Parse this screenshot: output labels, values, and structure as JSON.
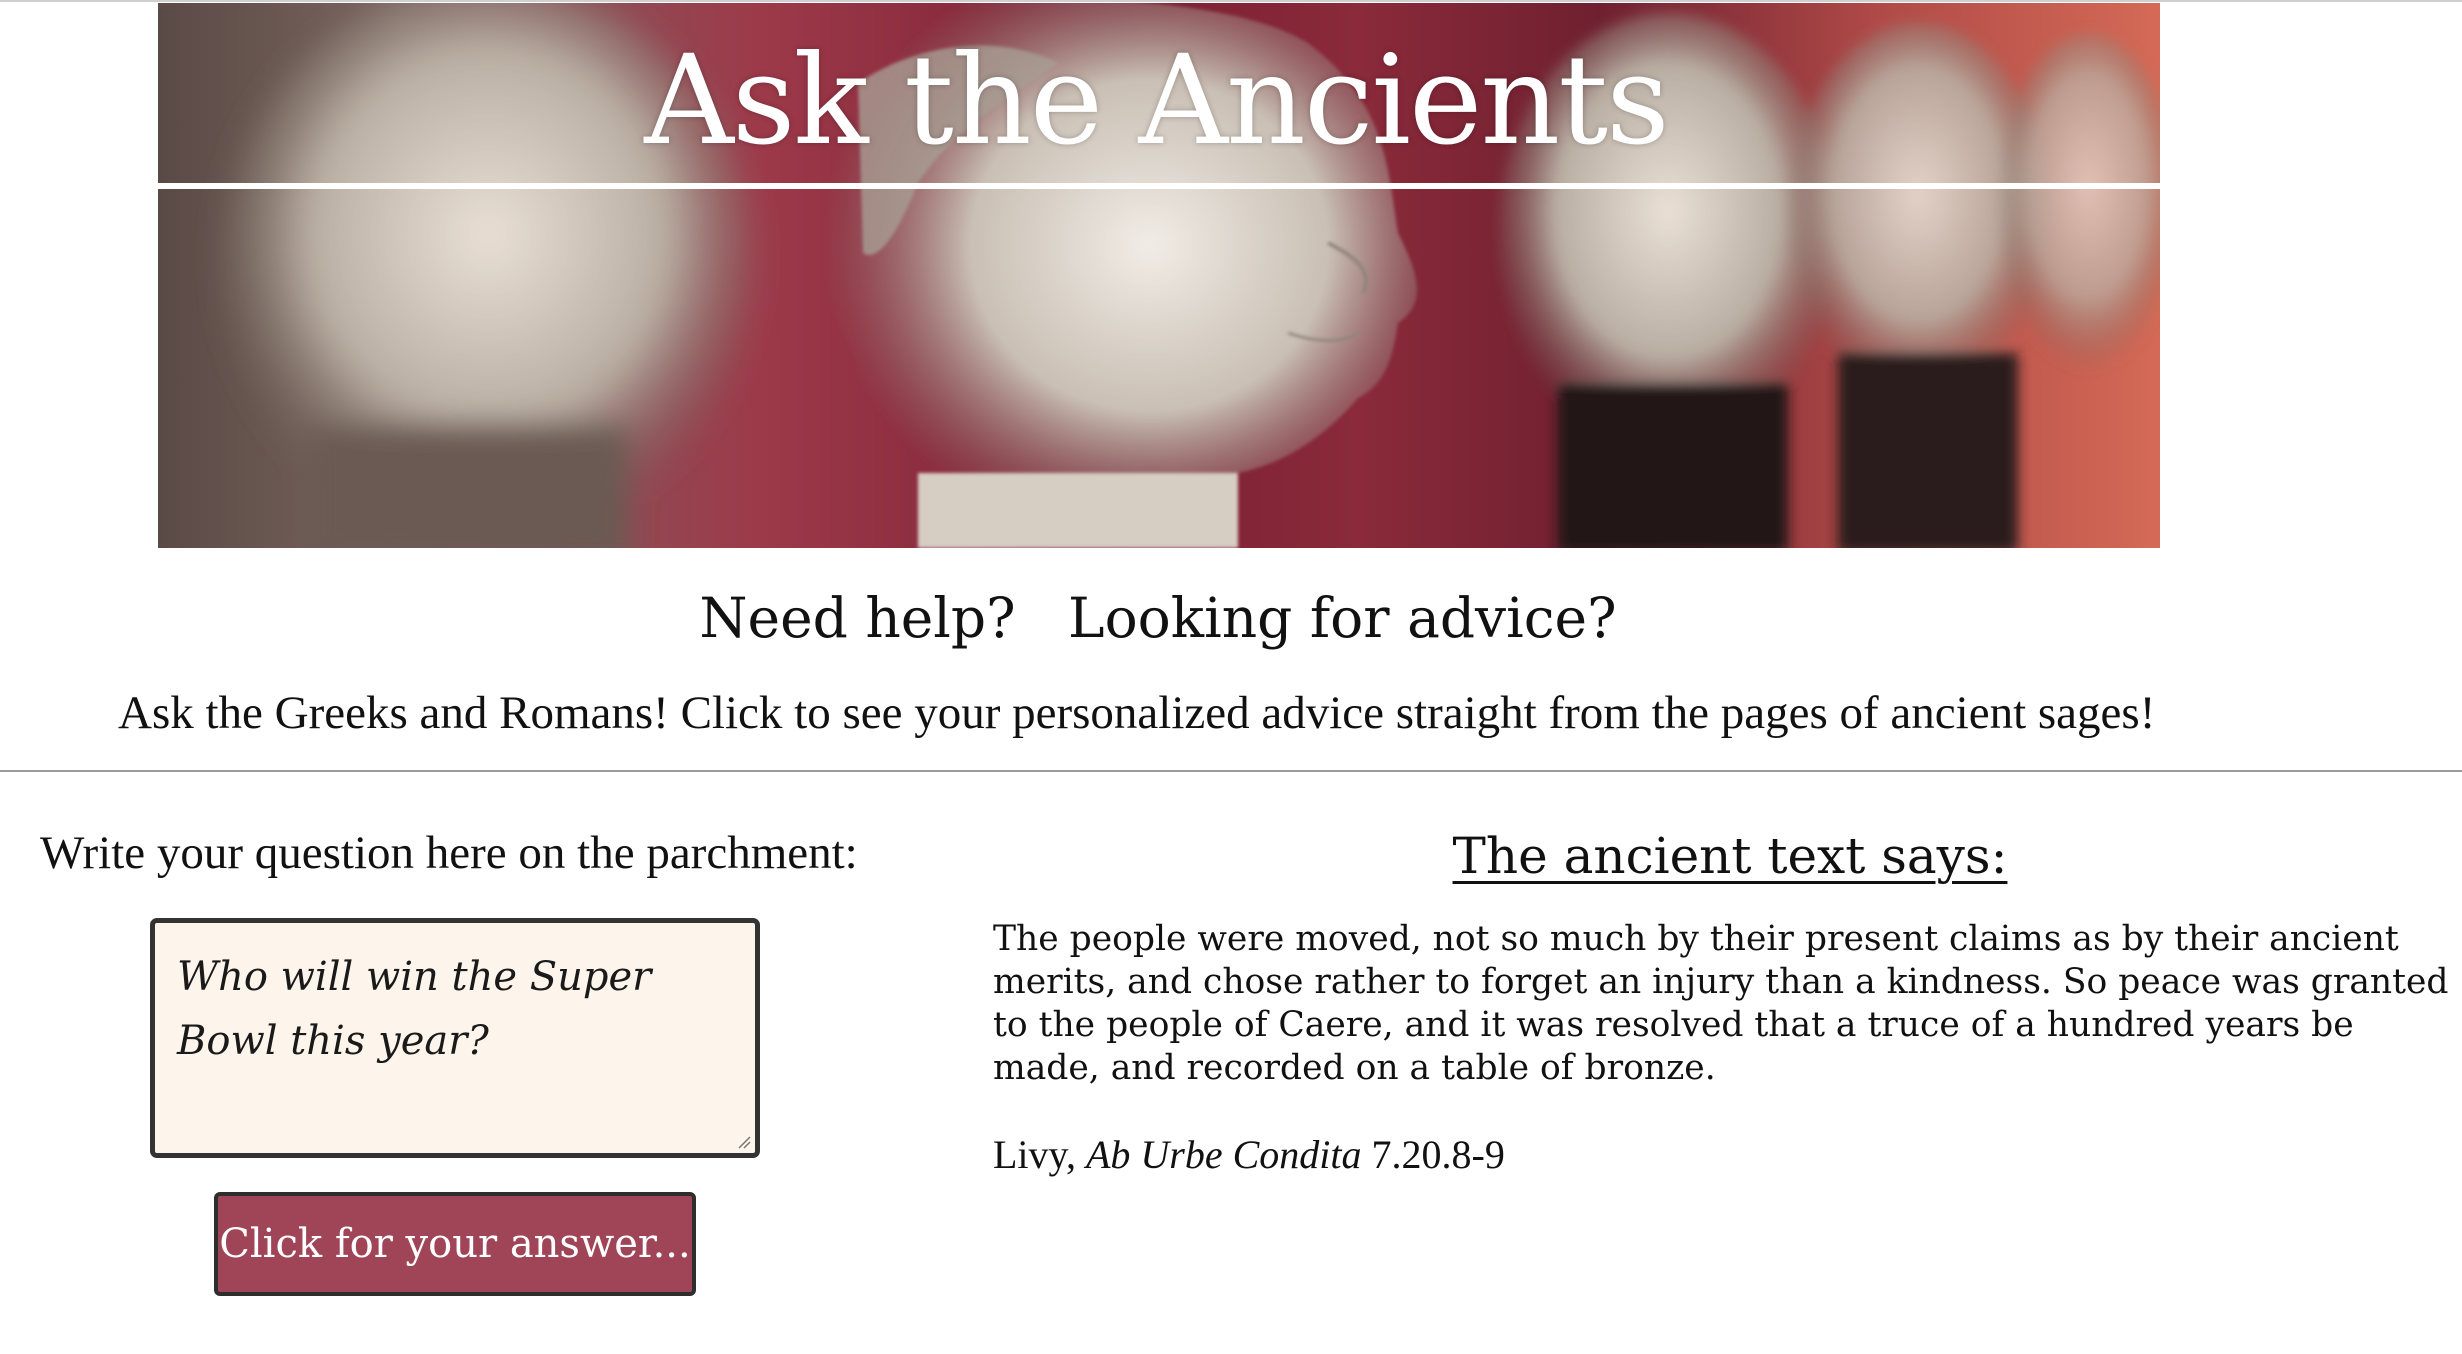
{
  "header": {
    "title": "Ask the Ancients"
  },
  "intro": {
    "heading": "Need help?   Looking for advice?",
    "description": "Ask the Greeks and Romans! Click to see your personalized advice straight from the pages of ancient sages!"
  },
  "question": {
    "label": "Write your question here on the parchment:",
    "value": "Who will win the Super Bowl this year?",
    "button_label": "Click for your answer..."
  },
  "answer": {
    "heading": "The ancient text says:",
    "text": "The people were moved, not so much by their present claims as by their ancient merits, and chose rather to forget an injury than a kindness. So peace was granted to the people of Caere, and it was resolved that a truce of a hundred years be made, and recorded on a table of bronze.",
    "citation": {
      "author": "Livy,",
      "work": "Ab Urbe Condita",
      "reference": "7.20.8-9"
    }
  },
  "colors": {
    "button_background": "#a04458",
    "parchment_background": "#fdf5ec",
    "hero_accent": "#7a1f33"
  }
}
